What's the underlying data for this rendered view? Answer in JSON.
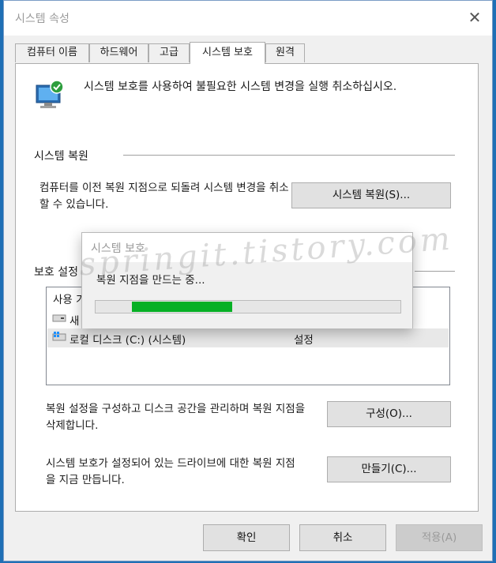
{
  "window": {
    "title": "시스템 속성"
  },
  "tabs": [
    {
      "label": "컴퓨터 이름"
    },
    {
      "label": "하드웨어"
    },
    {
      "label": "고급"
    },
    {
      "label": "시스템 보호"
    },
    {
      "label": "원격"
    }
  ],
  "intro_text": "시스템 보호를 사용하여 불필요한 시스템 변경을 실행 취소하십시오.",
  "restore_section": {
    "title": "시스템 복원",
    "description": "컴퓨터를 이전 복원 지점으로 되돌려 시스템 변경을 취소할 수 있습니다.",
    "button": "시스템 복원(S)..."
  },
  "protection_section": {
    "title": "보호 설정",
    "list_header": "사용 가",
    "drives": [
      {
        "name": "새 ",
        "status": "",
        "icon": "drive-icon"
      },
      {
        "name": "로컬 디스크 (C:) (시스템)",
        "status": "설정",
        "icon": "windows-drive-icon"
      }
    ]
  },
  "configure": {
    "description": "복원 설정을 구성하고 디스크 공간을 관리하며 복원 지점을 삭제합니다.",
    "button": "구성(O)..."
  },
  "create": {
    "description": "시스템 보호가 설정되어 있는 드라이브에 대한 복원 지점을 지금 만듭니다.",
    "button": "만들기(C)..."
  },
  "footer": {
    "ok": "확인",
    "cancel": "취소",
    "apply": "적용(A)"
  },
  "dialog": {
    "title": "시스템 보호",
    "message": "복원 지점을 만드는 중...",
    "progress_fraction": 0.33
  },
  "watermark": "springit.tistory.com",
  "colors": {
    "progress": "#06b025",
    "accent": "#1f6fb5"
  }
}
